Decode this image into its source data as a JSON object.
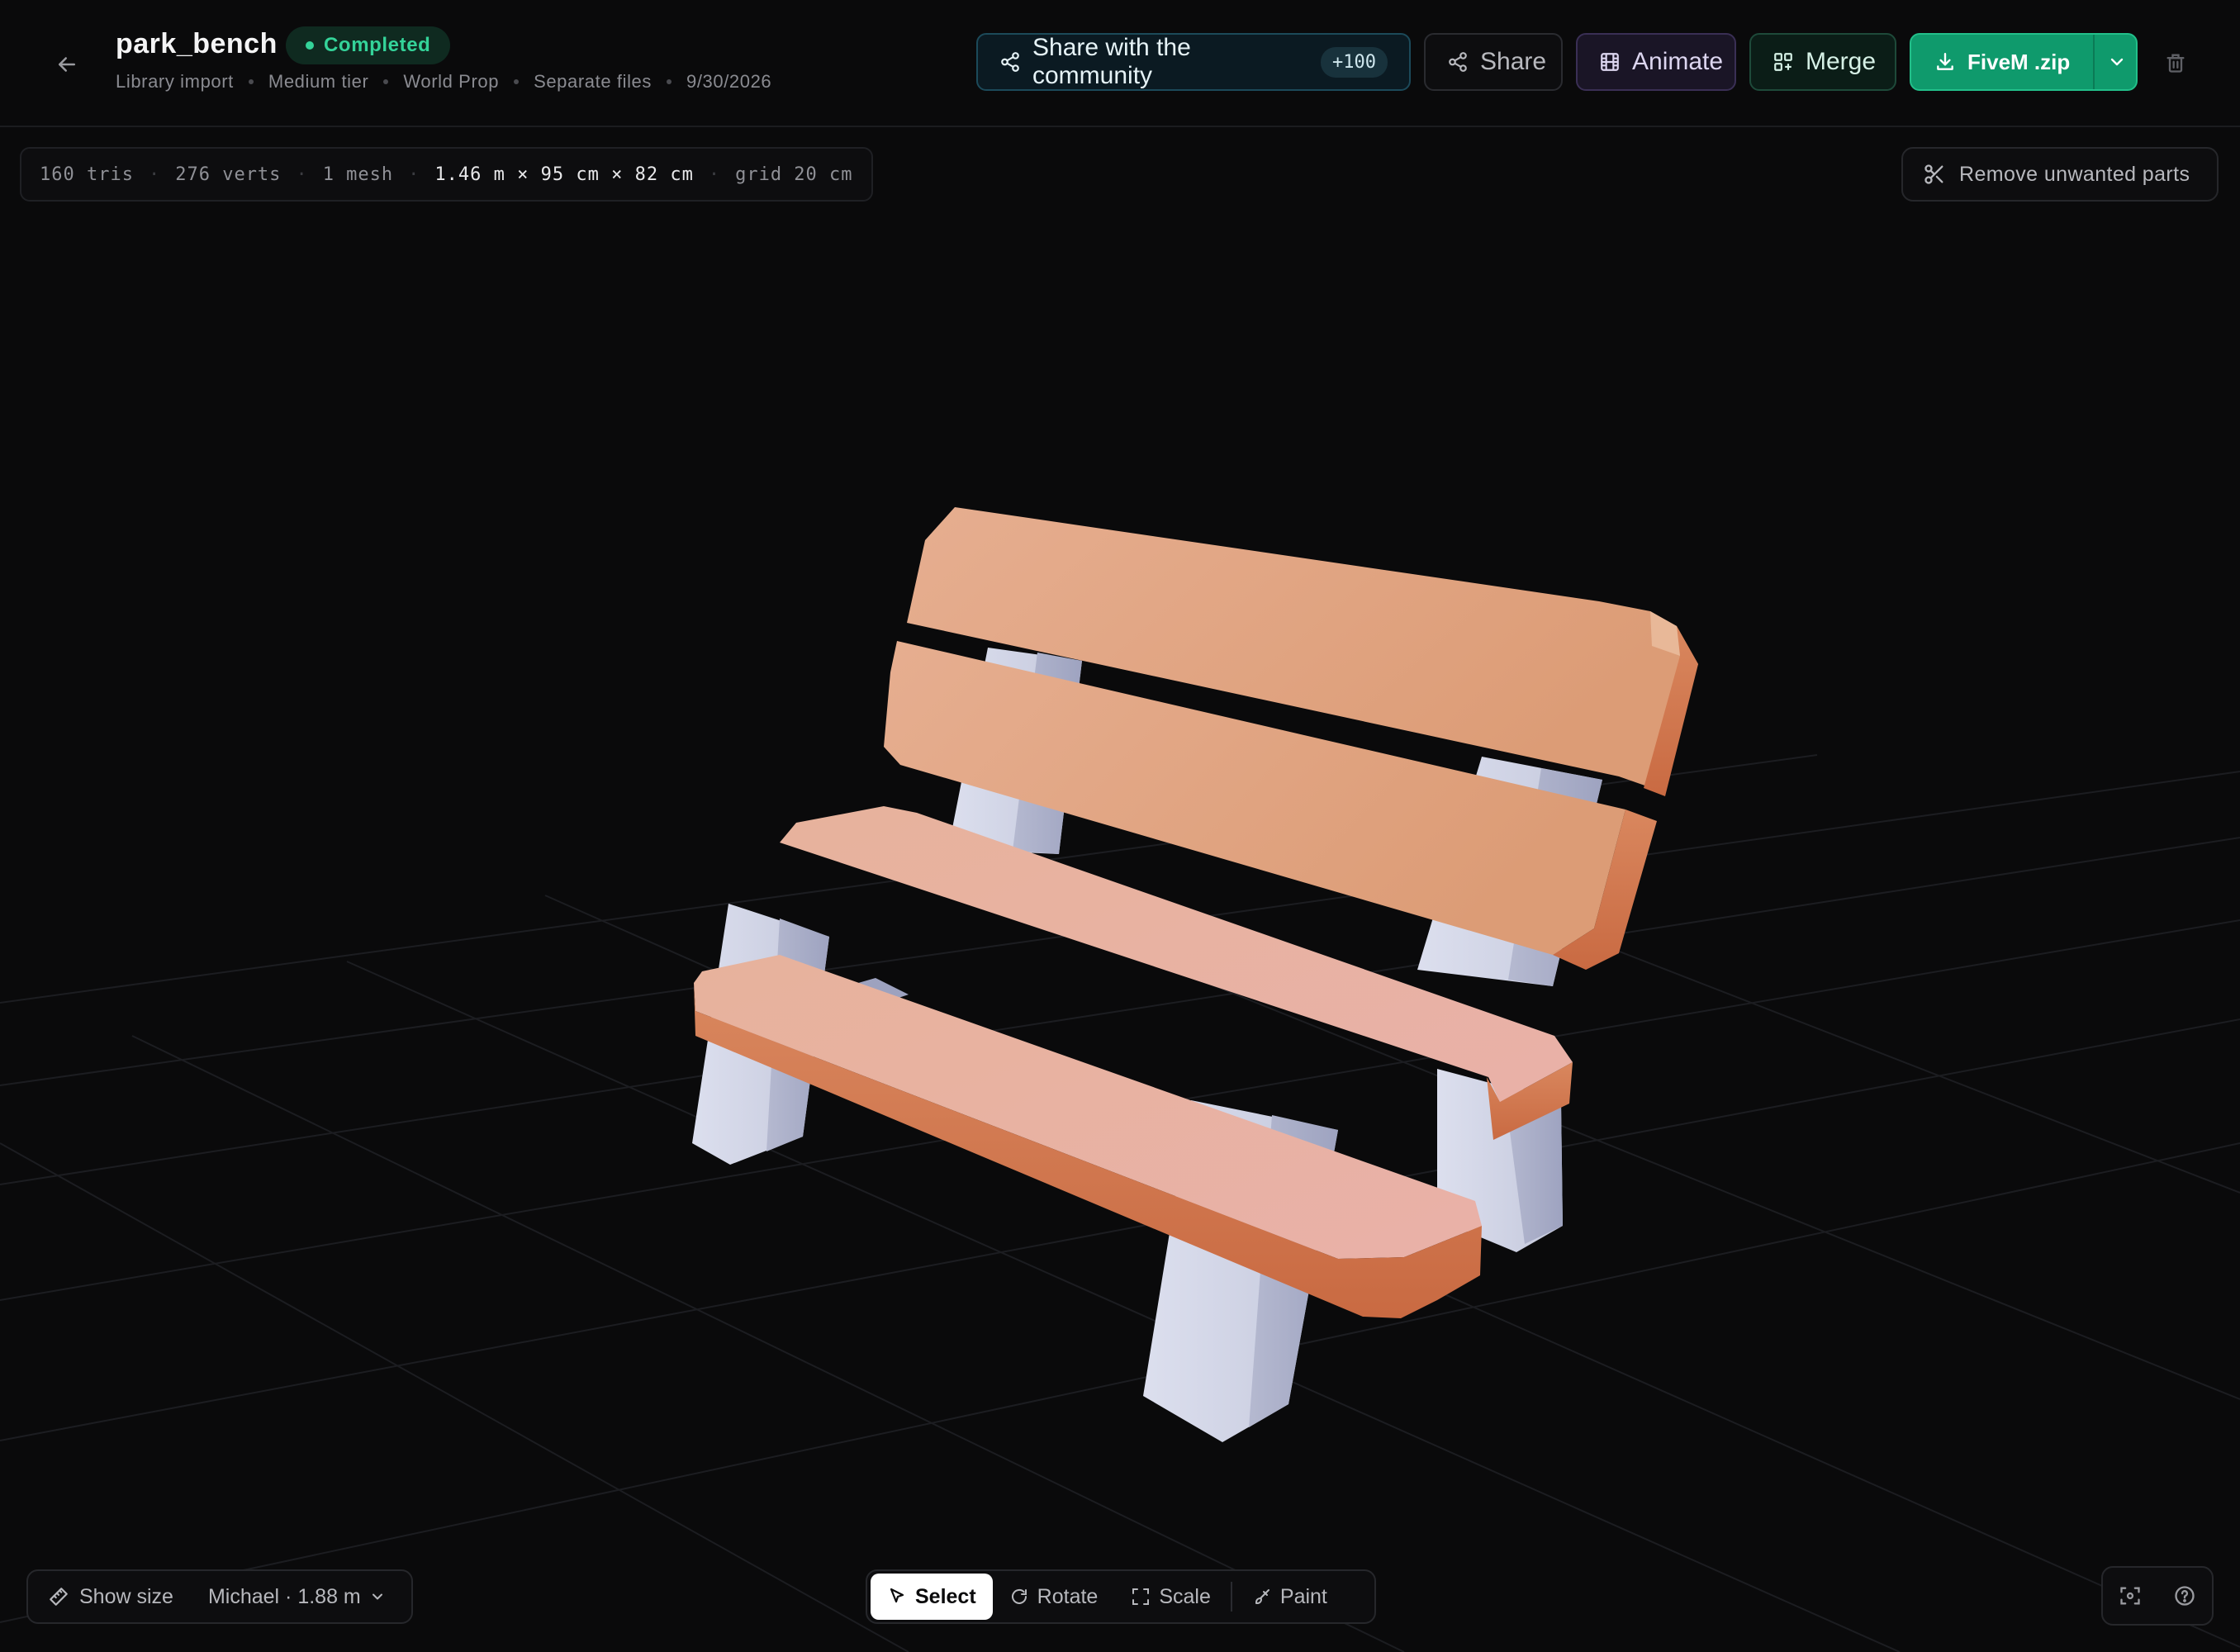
{
  "header": {
    "title": "park_bench",
    "status": "Completed",
    "meta": [
      "Library import",
      "Medium tier",
      "World Prop",
      "Separate files",
      "9/30/2026"
    ],
    "share_community": {
      "label": "Share with the community",
      "count": "+100"
    },
    "share_label": "Share",
    "animate_label": "Animate",
    "merge_label": "Merge",
    "download_label": "FiveM .zip"
  },
  "stats": {
    "tris": "160 tris",
    "verts": "276 verts",
    "meshes": "1 mesh",
    "dims": "1.46 m × 95 cm × 82 cm",
    "grid": "grid 20 cm"
  },
  "remove_parts_label": "Remove unwanted parts",
  "size_bar": {
    "show_size": "Show size",
    "person": "Michael · 1.88 m"
  },
  "tools": {
    "select": "Select",
    "rotate": "Rotate",
    "scale": "Scale",
    "paint": "Paint"
  },
  "colors": {
    "accent_green": "#0f9a6c",
    "status_green": "#34d399",
    "wood": "#e2a07c",
    "legs": "#c9ccdc"
  },
  "icons": [
    "back-arrow-icon",
    "share-nodes-icon",
    "film-icon",
    "merge-grid-icon",
    "download-icon",
    "chevron-down-icon",
    "trash-icon",
    "scissors-icon",
    "ruler-icon",
    "cursor-icon",
    "rotate-icon",
    "scale-icon",
    "brush-icon",
    "focus-icon",
    "help-icon"
  ]
}
